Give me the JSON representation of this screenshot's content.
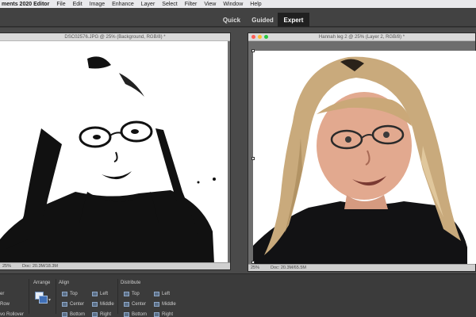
{
  "menubar": {
    "app_name": "ments 2020 Editor",
    "items": [
      "File",
      "Edit",
      "Image",
      "Enhance",
      "Layer",
      "Select",
      "Filter",
      "View",
      "Window",
      "Help"
    ]
  },
  "modes": {
    "quick": "Quick",
    "guided": "Guided",
    "expert": "Expert",
    "active": "Expert"
  },
  "documents": {
    "left": {
      "title": "DSC02576.JPG @ 25% (Background, RGB/8) *",
      "zoom": "25%",
      "doc_size": "Doc: 20.3M/18.3M"
    },
    "right": {
      "title": "Hannah leg 2 @ 25% (Layer 2, RGB/8) *",
      "zoom": "25%",
      "doc_size": "Doc: 20.3M/65.5M"
    }
  },
  "bottom_panel": {
    "left_labels": [
      "er",
      "Row",
      "vo Rollover"
    ],
    "arrange_label": "Arrange",
    "align": {
      "title": "Align",
      "items": [
        "Top",
        "Center",
        "Bottom",
        "Left",
        "Middle",
        "Right"
      ]
    },
    "distribute": {
      "title": "Distribute",
      "items": [
        "Top",
        "Center",
        "Bottom",
        "Left",
        "Middle",
        "Right"
      ]
    }
  },
  "colors": {
    "traffic_close": "#ff5f57",
    "traffic_minimize": "#febc2e",
    "traffic_zoom": "#28c840",
    "active_tab": "#202020"
  },
  "icons": [
    "traffic-light-icons",
    "arrange-icon",
    "align-top-icon",
    "align-center-icon",
    "align-bottom-icon",
    "align-left-icon",
    "align-middle-icon",
    "align-right-icon"
  ]
}
